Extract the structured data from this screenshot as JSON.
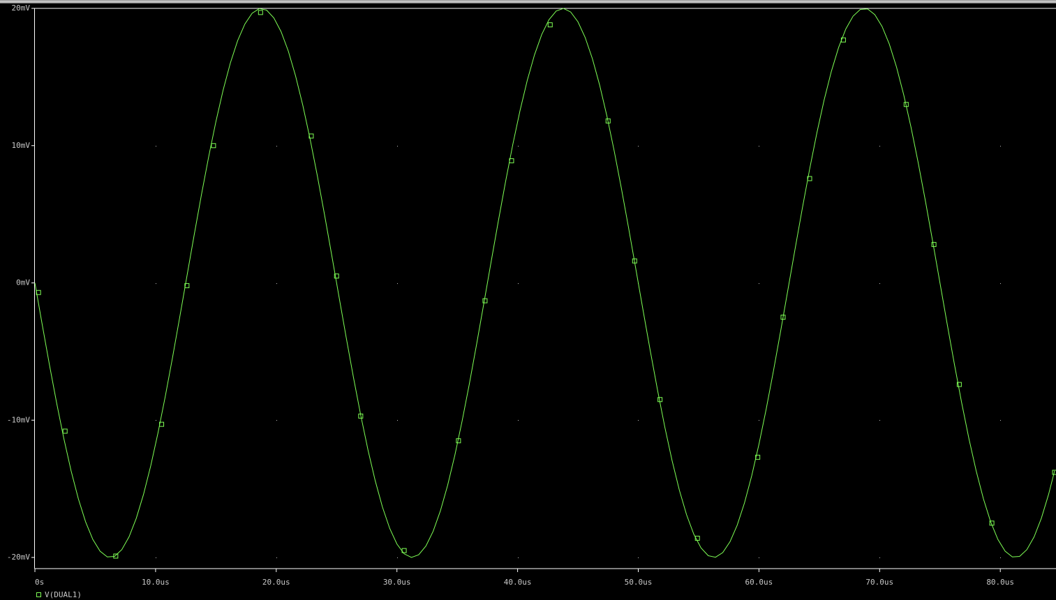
{
  "colors": {
    "background": "#000000",
    "trace": "#7fff55",
    "axis": "#ffffff",
    "text": "#c8c8c8",
    "grid_dot": "#bdbdbd"
  },
  "chart_data": {
    "type": "line",
    "title": "",
    "xlabel": "",
    "ylabel": "",
    "xlim": [
      0,
      84.5
    ],
    "ylim": [
      -20,
      20
    ],
    "grid": "dotted",
    "legend": "bottom-left",
    "x_unit": "us",
    "y_unit": "mV",
    "x_tick_values": [
      0,
      10,
      20,
      30,
      40,
      50,
      60,
      70,
      80
    ],
    "x_tick_labels": [
      "0s",
      "10.0us",
      "20.0us",
      "30.0us",
      "40.0us",
      "50.0us",
      "60.0us",
      "70.0us",
      "80.0us"
    ],
    "y_tick_values": [
      20,
      10,
      0,
      -10,
      -20
    ],
    "y_tick_labels": [
      "20mV",
      "10mV",
      "0mV",
      "-10mV",
      "-20mV"
    ],
    "series": [
      {
        "name": "V(DUAL1)",
        "marker": "square",
        "waveform": {
          "shape": "sine",
          "amplitude_mV": 20,
          "period_us": 25,
          "start_phase": "falling from 0"
        },
        "marker_points": [
          {
            "x": 0.3,
            "y": -0.7
          },
          {
            "x": 2.5,
            "y": -10.8
          },
          {
            "x": 6.7,
            "y": -19.9
          },
          {
            "x": 10.5,
            "y": -10.3
          },
          {
            "x": 12.6,
            "y": -0.2
          },
          {
            "x": 14.8,
            "y": 10.0
          },
          {
            "x": 18.7,
            "y": 19.7
          },
          {
            "x": 22.9,
            "y": 10.7
          },
          {
            "x": 25.0,
            "y": 0.5
          },
          {
            "x": 27.0,
            "y": -9.7
          },
          {
            "x": 30.6,
            "y": -19.5
          },
          {
            "x": 35.1,
            "y": -11.5
          },
          {
            "x": 37.3,
            "y": -1.3
          },
          {
            "x": 39.5,
            "y": 8.9
          },
          {
            "x": 42.7,
            "y": 18.8
          },
          {
            "x": 47.5,
            "y": 11.8
          },
          {
            "x": 49.7,
            "y": 1.6
          },
          {
            "x": 51.8,
            "y": -8.5
          },
          {
            "x": 54.9,
            "y": -18.6
          },
          {
            "x": 59.9,
            "y": -12.7
          },
          {
            "x": 62.0,
            "y": -2.5
          },
          {
            "x": 64.2,
            "y": 7.6
          },
          {
            "x": 67.0,
            "y": 17.7
          },
          {
            "x": 72.2,
            "y": 13.0
          },
          {
            "x": 74.5,
            "y": 2.8
          },
          {
            "x": 76.6,
            "y": -7.4
          },
          {
            "x": 79.3,
            "y": -17.5
          },
          {
            "x": 84.5,
            "y": -13.8
          }
        ]
      }
    ]
  }
}
